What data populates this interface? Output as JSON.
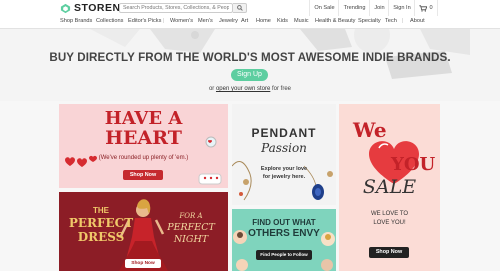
{
  "brand": {
    "name": "STORENVY",
    "accent": "#5dcea0"
  },
  "search": {
    "placeholder": "Search Products, Stores, Collections, & People"
  },
  "top_nav": {
    "on_sale": "On Sale",
    "trending": "Trending",
    "join": "Join",
    "sign_in": "Sign In",
    "cart_count": "0"
  },
  "categories": [
    "Shop Brands",
    "Collections",
    "Editor's Picks",
    "Women's",
    "Men's",
    "Jewelry",
    "Art",
    "Home",
    "Kids",
    "Music",
    "Health & Beauty",
    "Specialty",
    "Tech",
    "About"
  ],
  "hero": {
    "title": "BUY DIRECTLY FROM THE WORLD'S MOST AWESOME INDIE BRANDS.",
    "signup_label": "Sign Up",
    "or_prefix": "or",
    "own_store_link": "open your own store",
    "or_suffix": "for free"
  },
  "tiles": {
    "heart": {
      "line1": "HAVE A",
      "line2": "HEART",
      "subtitle": "(We've rounded up plenty of 'em.)",
      "button": "Shop Now"
    },
    "dress": {
      "line1": "THE",
      "line2": "PERFECT",
      "line3": "DRESS",
      "right1": "FOR A",
      "right2": "PERFECT",
      "right3": "NIGHT",
      "button": "Shop Now"
    },
    "pendant": {
      "title": "PENDANT",
      "script": "Passion",
      "desc_line1": "Explore your love",
      "desc_line2": "for jewelry here."
    },
    "envy": {
      "line1": "FIND OUT WHAT",
      "line2": "OTHERS ENVY",
      "button": "Find People to Follow"
    },
    "love": {
      "we": "We",
      "you": "YOU",
      "sale": "SALE",
      "text_line1": "WE LOVE TO",
      "text_line2": "LOVE YOU!",
      "button": "Shop Now"
    }
  }
}
